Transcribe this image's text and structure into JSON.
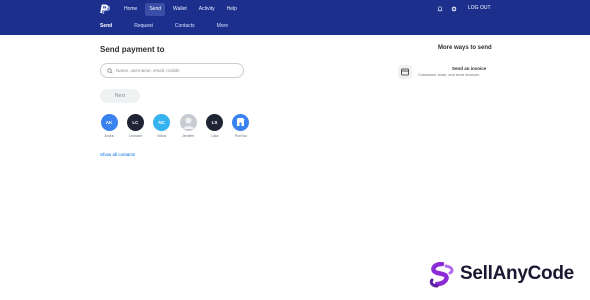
{
  "header": {
    "nav": [
      {
        "label": "Home",
        "active": false
      },
      {
        "label": "Send",
        "active": true
      },
      {
        "label": "Wallet",
        "active": false
      },
      {
        "label": "Activity",
        "active": false
      },
      {
        "label": "Help",
        "active": false
      }
    ],
    "logout_label": "LOG OUT",
    "icons": {
      "brand": "paypal-logo",
      "notifications": "bell-icon",
      "settings": "gear-icon"
    },
    "bg_color": "#1c2f8d"
  },
  "subnav": [
    {
      "label": "Send",
      "active": true
    },
    {
      "label": "Request",
      "active": false
    },
    {
      "label": "Contacts",
      "active": false
    },
    {
      "label": "More",
      "active": false
    }
  ],
  "main": {
    "title": "Send payment to",
    "search": {
      "placeholder": "Name, username, email, mobile",
      "value": ""
    },
    "next_label": "Next",
    "contacts": [
      {
        "initials": "AK",
        "name": "Andra",
        "color": "#3a82f0"
      },
      {
        "initials": "LC",
        "name": "Leonard",
        "color": "#1e2433"
      },
      {
        "initials": "NC",
        "name": "Nikos",
        "color": "#35b3f0"
      },
      {
        "initials": "",
        "name": "Jennifer",
        "color": "#c8ccd2"
      },
      {
        "initials": "LS",
        "name": "Luka",
        "color": "#1e2433"
      },
      {
        "initials": "",
        "name": "PunYou",
        "color": "#3a82f0"
      }
    ],
    "show_all_label": "Show all contacts"
  },
  "side": {
    "title": "More ways to send",
    "invoice_title": "Send an invoice",
    "invoice_desc": "Customize, track, and send invoices."
  },
  "watermark": {
    "text": "SellAnyCode",
    "accent": "#8b2bd6"
  }
}
